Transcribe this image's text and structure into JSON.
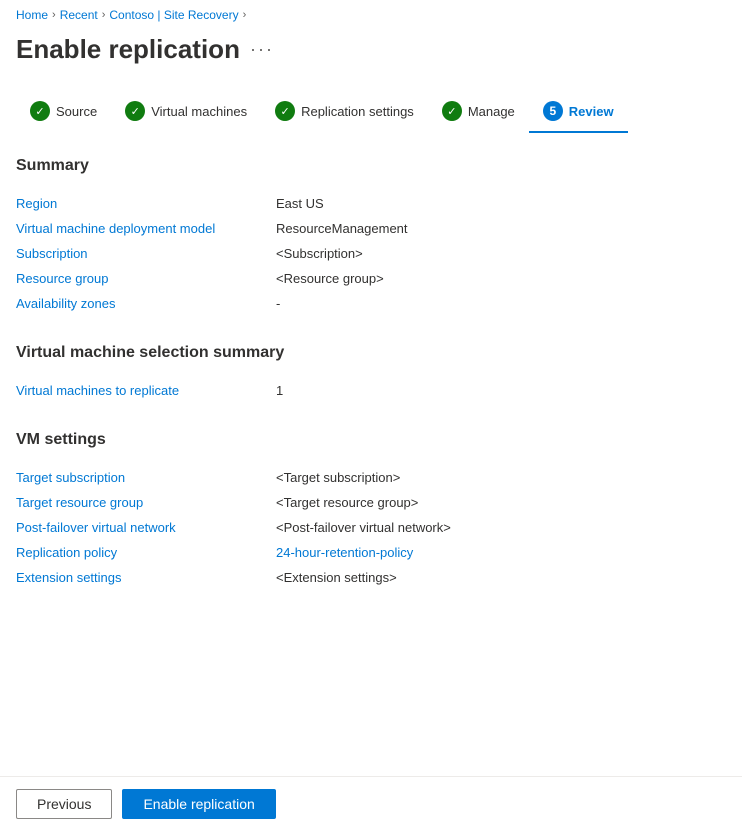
{
  "breadcrumb": {
    "items": [
      {
        "label": "Home",
        "href": "#"
      },
      {
        "label": "Recent",
        "href": "#"
      },
      {
        "label": "Contoso | Site Recovery",
        "href": "#",
        "highlight": true
      }
    ]
  },
  "pageTitle": "Enable replication",
  "moreLabel": "···",
  "steps": [
    {
      "label": "Source",
      "status": "complete",
      "index": 1
    },
    {
      "label": "Virtual machines",
      "status": "complete",
      "index": 2
    },
    {
      "label": "Replication settings",
      "status": "complete",
      "index": 3
    },
    {
      "label": "Manage",
      "status": "complete",
      "index": 4
    },
    {
      "label": "Review",
      "status": "active",
      "num": "5"
    }
  ],
  "summary": {
    "title": "Summary",
    "rows": [
      {
        "label": "Region",
        "value": "East US",
        "type": "text"
      },
      {
        "label": "Virtual machine deployment model",
        "value": "ResourceManagement",
        "type": "text"
      },
      {
        "label": "Subscription",
        "value": "<Subscription>",
        "type": "text"
      },
      {
        "label": "Resource group",
        "value": "<Resource group>",
        "type": "text"
      },
      {
        "label": "Availability zones",
        "value": "-",
        "type": "text"
      }
    ]
  },
  "vmSelectionSummary": {
    "title": "Virtual machine selection summary",
    "rows": [
      {
        "label": "Virtual machines to replicate",
        "value": "1",
        "type": "text"
      }
    ]
  },
  "vmSettings": {
    "title": "VM settings",
    "rows": [
      {
        "label": "Target subscription",
        "value": "<Target subscription>",
        "type": "text"
      },
      {
        "label": "Target resource group",
        "value": "<Target resource group>",
        "type": "text"
      },
      {
        "label": "Post-failover virtual network",
        "value": "<Post-failover virtual network>",
        "type": "text"
      },
      {
        "label": "Replication policy",
        "value": "24-hour-retention-policy",
        "type": "link"
      },
      {
        "label": "Extension settings",
        "value": "<Extension settings>",
        "type": "text"
      }
    ]
  },
  "footer": {
    "previousLabel": "Previous",
    "enableLabel": "Enable replication"
  }
}
